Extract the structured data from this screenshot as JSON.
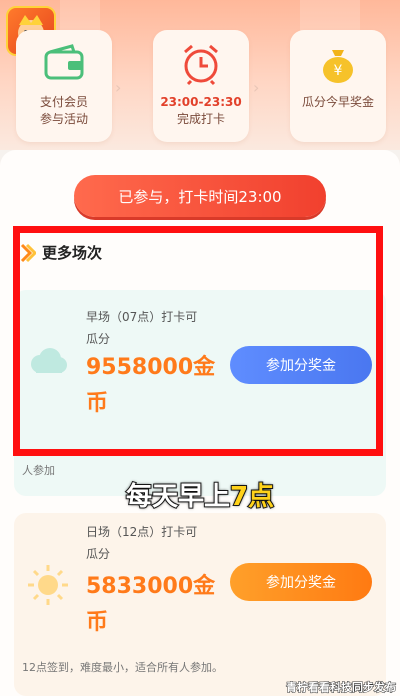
{
  "steps": [
    {
      "label_line1": "支付会员",
      "label_line2": "参与活动",
      "icon": "wallet-icon"
    },
    {
      "label_line1": "23:00-23:30",
      "label_line2": "完成打卡",
      "icon": "alarm-clock-icon"
    },
    {
      "label_line1": "瓜分今早奖金",
      "label_line2": "",
      "icon": "money-bag-icon"
    }
  ],
  "status_button": "已参与，打卡时间23:00",
  "section_title": "更多场次",
  "sessions": [
    {
      "slot_line1": "早场（07点）打卡可",
      "slot_line2": "瓜分",
      "amount_line1": "9558000金",
      "amount_line2": "币",
      "button": "参加分奖金",
      "desc": "人参加",
      "icon": "cloud-icon",
      "accent": "#4a77f0"
    },
    {
      "slot_line1": "日场（12点）打卡可",
      "slot_line2": "瓜分",
      "amount_line1": "5833000金",
      "amount_line2": "币",
      "button": "参加分奖金",
      "desc": "12点签到，难度最小，适合所有人参加。",
      "icon": "sun-icon",
      "accent": "#ff7a12"
    }
  ],
  "caption_prefix": "每天早上",
  "caption_highlight": "7点",
  "watermark": "青柠看看科技同步发布",
  "colors": {
    "highlight_box": "#ff1010",
    "amount": "#ff7a1a",
    "status_btn": "#f1402e"
  }
}
